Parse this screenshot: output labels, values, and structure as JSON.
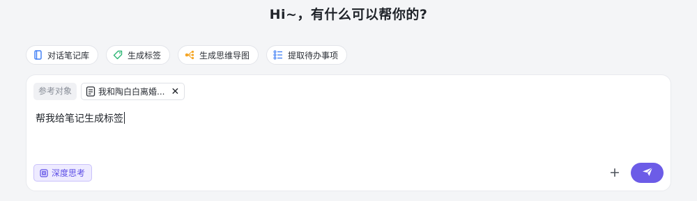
{
  "greeting": "Hi~，有什么可以帮你的?",
  "quick_actions": [
    {
      "label": "对话笔记库",
      "icon": "notebook-icon"
    },
    {
      "label": "生成标签",
      "icon": "tag-icon"
    },
    {
      "label": "生成思维导图",
      "icon": "mindmap-icon"
    },
    {
      "label": "提取待办事项",
      "icon": "checklist-icon"
    }
  ],
  "composer": {
    "reference_label": "参考对象",
    "reference_doc": "我和陶白白离婚...",
    "input_value": "帮我给笔记生成标签",
    "deep_think_label": "深度思考",
    "plus_label": "+"
  },
  "colors": {
    "accent": "#6c5ce7",
    "notebook_icon": "#3b7cf5",
    "tag_icon": "#2bb673",
    "mindmap_icon": "#f5a524",
    "checklist_icon": "#3b7cf5"
  }
}
